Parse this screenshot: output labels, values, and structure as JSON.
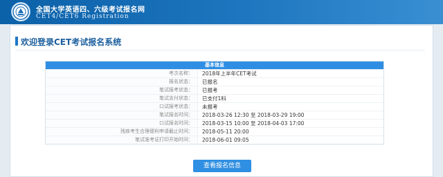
{
  "header": {
    "title": "全国大学英语四、六级考试报名网",
    "subtitle": "CET4/CET6 Registration"
  },
  "page": {
    "welcome": "欢迎登录CET考试报名系统"
  },
  "info_panel": {
    "heading": "基本信息",
    "rows": [
      {
        "label": "考次名称：",
        "value": "2018年上半年CET考试"
      },
      {
        "label": "报名状态：",
        "value": "已报名"
      },
      {
        "label": "笔试报考状态：",
        "value": "已报考"
      },
      {
        "label": "笔试支付状态：",
        "value": "已支付1科"
      },
      {
        "label": "口试报考状态：",
        "value": "未报考"
      },
      {
        "label": "笔试报名时间：",
        "value": "2018-03-26 12:30 至 2018-03-29 19:00"
      },
      {
        "label": "口试报名时间：",
        "value": "2018-03-15 10:00 至 2018-04-03 17:00"
      },
      {
        "label": "残疾考生合理便利申请截止时间：",
        "value": "2018-05-11 20:00"
      },
      {
        "label": "笔试准考证打印开始时间：",
        "value": "2018-06-01 09:05"
      }
    ]
  },
  "actions": {
    "view_info_label": "查看报名信息"
  }
}
